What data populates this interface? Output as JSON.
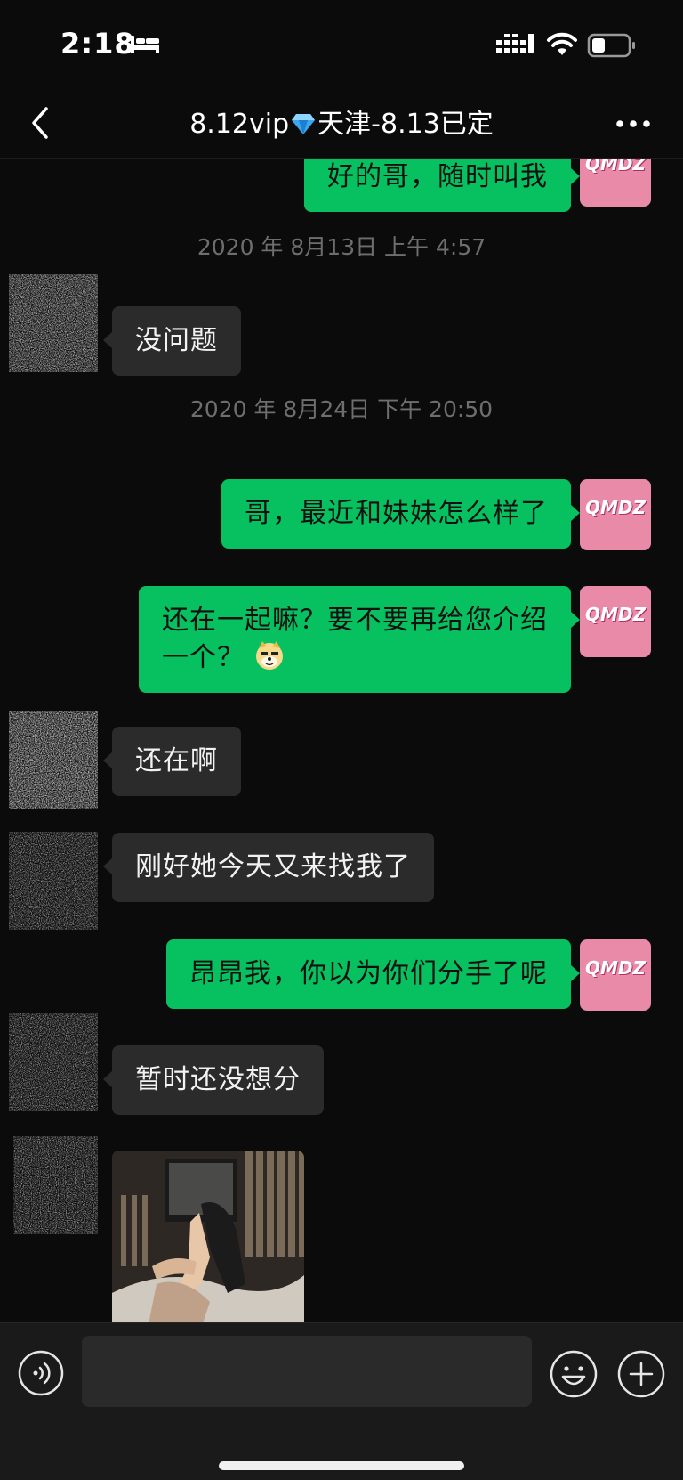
{
  "status_bar": {
    "time": "2:18"
  },
  "header": {
    "title_prefix": "8.12vip",
    "title_suffix": "天津-8.13已定",
    "gem_icon": "gem-icon"
  },
  "messages": [
    {
      "direction": "out",
      "text": "好的哥，随时叫我"
    },
    {
      "type": "time",
      "text": "2020 年 8月13日 上午 4:57"
    },
    {
      "direction": "in",
      "text": "没问题"
    },
    {
      "type": "time",
      "text": "2020 年 8月24日 下午 20:50"
    },
    {
      "direction": "out",
      "text": "哥，最近和妹妹怎么样了"
    },
    {
      "direction": "out",
      "line1": "还在一起嘛？要不要再给您介绍",
      "line2": "一个？",
      "emoji": "doge-emoji"
    },
    {
      "direction": "in",
      "text": "还在啊"
    },
    {
      "direction": "in",
      "text": "刚好她今天又来找我了"
    },
    {
      "direction": "out",
      "text": "昂昂我，你以为你们分手了呢"
    },
    {
      "direction": "in",
      "text": "暂时还没想分"
    },
    {
      "direction": "in",
      "type": "image"
    }
  ],
  "self_avatar": {
    "logo_text": "QMDZ"
  },
  "input_bar": {
    "placeholder": ""
  },
  "colors": {
    "outgoing_bubble": "#07c160",
    "incoming_bubble": "#2b2b2b",
    "background": "#0b0b0b"
  }
}
